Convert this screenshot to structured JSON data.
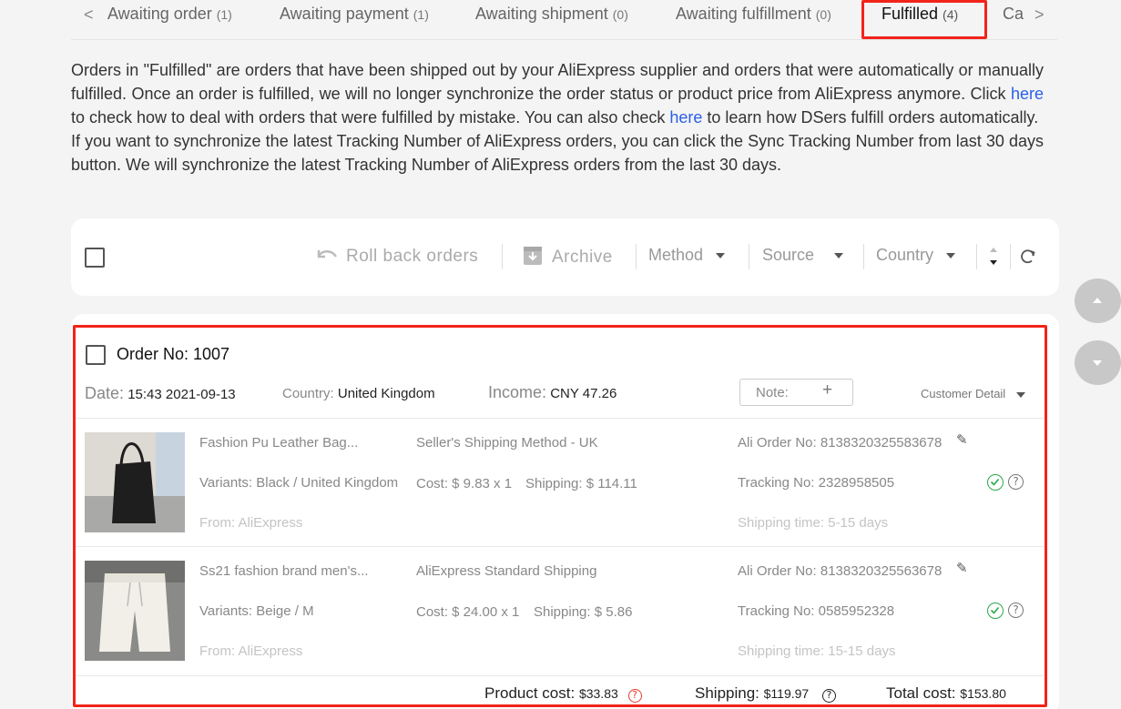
{
  "tabs": {
    "items": [
      {
        "label": "Awaiting order",
        "count": "(1)"
      },
      {
        "label": "Awaiting payment",
        "count": "(1)"
      },
      {
        "label": "Awaiting shipment",
        "count": "(0)"
      },
      {
        "label": "Awaiting fulfillment",
        "count": "(0)"
      },
      {
        "label": "Fulfilled",
        "count": "(4)"
      },
      {
        "label": "Ca"
      }
    ],
    "prev": "<",
    "next": ">",
    "active": "Fulfilled"
  },
  "description": {
    "p1_a": "Orders in \"Fulfilled\" are orders that have been shipped out by your AliExpress supplier and orders that were automatically or manually fulfilled. Once an order is fulfilled, we will no longer synchronize the order status or product price from AliExpress anymore. Click ",
    "link1": "here",
    "p1_b": " to check how to deal with orders that were fulfilled by mistake. You can also check ",
    "link2": "here",
    "p1_c": " to learn how DSers fulfill orders automatically.",
    "p2": "If you want to synchronize the latest Tracking Number of AliExpress orders, you can click the Sync Tracking Number from last 30 days button. We will synchronize the latest Tracking Number of AliExpress orders from the last 30 days."
  },
  "toolbar": {
    "rollback": "Roll back orders",
    "archive": "Archive",
    "method": "Method",
    "source": "Source",
    "country": "Country"
  },
  "order": {
    "title": "Order No: 1007",
    "date_label": "Date:",
    "date": "15:43 2021-09-13",
    "country_label": "Country:",
    "country": "United Kingdom",
    "income_label": "Income:",
    "income": "CNY 47.26",
    "note_label": "Note:",
    "note_plus": "+",
    "customer_detail": "Customer Detail",
    "products": [
      {
        "name": "Fashion Pu Leather Bag...",
        "variants": "Variants: Black / United Kingdom",
        "from": "From: AliExpress",
        "method": "Seller's Shipping Method - UK",
        "cost": "Cost: $ 9.83 x 1",
        "shipping": "Shipping: $ 114.11",
        "ali_order": "Ali Order No: 8138320325583678",
        "tracking": "Tracking No: 2328958505",
        "shipping_time": "Shipping time: 5-15 days"
      },
      {
        "name": "Ss21 fashion brand men's...",
        "variants": "Variants: Beige / M",
        "from": "From: AliExpress",
        "method": "AliExpress Standard Shipping",
        "cost": "Cost: $ 24.00 x 1",
        "shipping": "Shipping: $ 5.86",
        "ali_order": "Ali Order No: 8138320325563678",
        "tracking": "Tracking No: 0585952328",
        "shipping_time": "Shipping time: 15-15 days"
      }
    ],
    "totals": {
      "product_cost_label": "Product cost:",
      "product_cost": "$33.83",
      "shipping_label": "Shipping:",
      "shipping": "$119.97",
      "total_label": "Total cost:",
      "total": "$153.80"
    }
  },
  "colors": {
    "highlight": "#f2231a",
    "link": "#2b5ee8",
    "success": "#2aa84a"
  }
}
